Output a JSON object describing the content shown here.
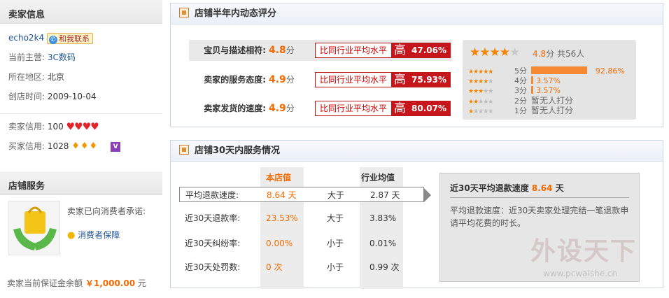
{
  "seller": {
    "title": "卖家信息",
    "name": "echo2k4",
    "contact_label": "和我联系",
    "category_label": "当前主营:",
    "category": "3C数码",
    "location_label": "所在地区:",
    "location": "北京",
    "created_label": "创店时间:",
    "created": "2009-10-04",
    "seller_credit_label": "卖家信用:",
    "seller_credit": "100",
    "seller_hearts": "♥♥♥♥",
    "buyer_credit_label": "买家信用:",
    "buyer_credit": "1028",
    "buyer_gems": "♦♦♦",
    "vip_badge": "V"
  },
  "shop_service": {
    "title": "店铺服务",
    "promise_label": "卖家已向消费者承诺:",
    "guarantee_link": "消费者保障",
    "deposit_label": "卖家当前保证金余额",
    "deposit_value": "￥1,000.00",
    "deposit_unit": "元"
  },
  "dsr": {
    "title": "店铺半年内动态评分",
    "unit": "分",
    "compare_label": "比同行业平均水平",
    "higher_label": "高",
    "rows": [
      {
        "label": "宝贝与描述相符:",
        "score": "4.8",
        "pct": "47.06%"
      },
      {
        "label": "卖家的服务态度:",
        "score": "4.9",
        "pct": "75.93%"
      },
      {
        "label": "卖家发货的速度:",
        "score": "4.9",
        "pct": "80.07%"
      }
    ],
    "summary": {
      "rating": 4.8,
      "score": "4.8",
      "unit": "分",
      "total": "共56人"
    },
    "breakdown": [
      {
        "stars": 5,
        "level": "5分",
        "fraction": 0.9286,
        "pct": "92.86%"
      },
      {
        "stars": 4,
        "level": "4分",
        "fraction": 0.0357,
        "pct": "3.57%"
      },
      {
        "stars": 3,
        "level": "3分",
        "fraction": 0.0357,
        "pct": "3.57%"
      },
      {
        "stars": 2,
        "level": "2分",
        "fraction": 0,
        "pct": "暂无人打分"
      },
      {
        "stars": 1,
        "level": "1分",
        "fraction": 0,
        "pct": "暂无人打分"
      }
    ]
  },
  "service30": {
    "title": "店铺30天内服务情况",
    "col_shop": "本店值",
    "col_industry": "行业均值",
    "rows": [
      {
        "label": "平均退款速度:",
        "shop": "8.64 天",
        "cmp": "大于",
        "avg": "2.87 天"
      },
      {
        "label": "近30天退款率:",
        "shop": "23.53%",
        "cmp": "大于",
        "avg": "3.83%"
      },
      {
        "label": "近30天纠纷率:",
        "shop": "0.00%",
        "cmp": "小于",
        "avg": "0.01%"
      },
      {
        "label": "近30天处罚数:",
        "shop": "0 次",
        "cmp": "小于",
        "avg": "0.99 次"
      }
    ],
    "info": {
      "title_prefix": "近30天平均退款速度",
      "value": "8.64",
      "unit": "天",
      "desc": "平均退款速度：近30天卖家处理完结一笔退款申请平均花费的时长。"
    }
  },
  "watermark": {
    "brand": "外设天下",
    "url": "www.pcwaishe.cn"
  },
  "colors": {
    "accent_orange": "#f56a00",
    "red": "#c6161b",
    "link_blue": "#1e5494"
  }
}
